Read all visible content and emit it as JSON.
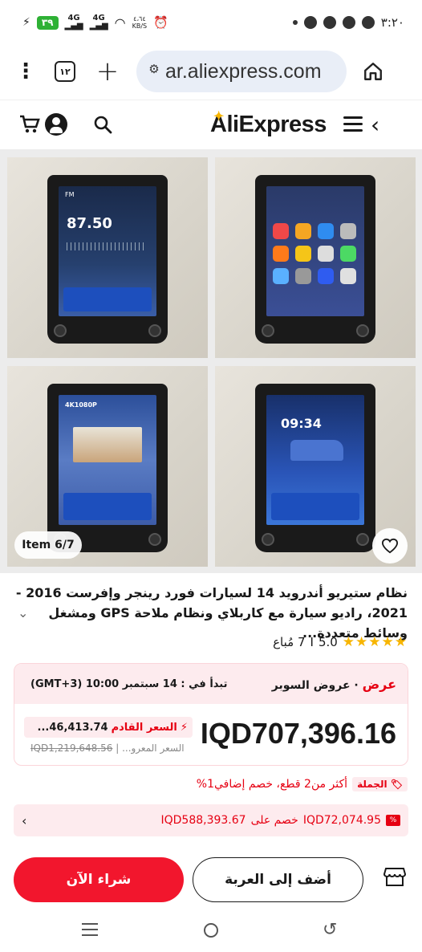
{
  "status_bar": {
    "time": "٣:٢٠",
    "battery": "٣٩",
    "network1": "4G",
    "network2": "4G",
    "speed_value": "٤،٦٤",
    "speed_unit": "KB/S"
  },
  "browser": {
    "menu_glyph": "⋮",
    "tab_count": "١٢",
    "new_tab_glyph": "+",
    "url": "ar.aliexpress.com"
  },
  "header": {
    "logo": "AliExpress"
  },
  "gallery": {
    "item_badge": "Item 6/7",
    "screen1_freq": "87.50",
    "screen1_label": "FM",
    "screen3_label": "4K1080P",
    "screen4_time": "09:34"
  },
  "product": {
    "title": "نظام ستيريو أندرويد 14 لسيارات فورد رينجر وإفرست 2016 - 2021، راديو سيارة مع كاربلاي ونظام ملاحة GPS ومشغل وسائط متعددة...",
    "rating_value": "5.0",
    "sold": "7 مُباع",
    "separator": "I"
  },
  "deal": {
    "label_offer": "عرض",
    "label_super": "عروض السوبر",
    "start_text": "تبدأ في : 14 سبتمبر 10:00 (GMT+3)",
    "price": "IQD707,396.16",
    "next_price_label": "السعر القادم",
    "next_price_value": "46,413.74...",
    "old_price": "IQD1,219,648.56",
    "old_price_label": "السعر المعرو..."
  },
  "bulk": {
    "tag": "الجملة",
    "text": "أكثر من2 قطع، خصم إضافي1%"
  },
  "coupon": {
    "discount": "IQD72,074.95",
    "mid_text": "خصم على",
    "threshold": "IQD588,393.67"
  },
  "actions": {
    "add_to_cart": "أضف إلى العربة",
    "buy_now": "شراء الآن"
  },
  "colors": {
    "accent": "#f2162d",
    "deal_bg": "#fdebee",
    "star": "#f7b500"
  }
}
